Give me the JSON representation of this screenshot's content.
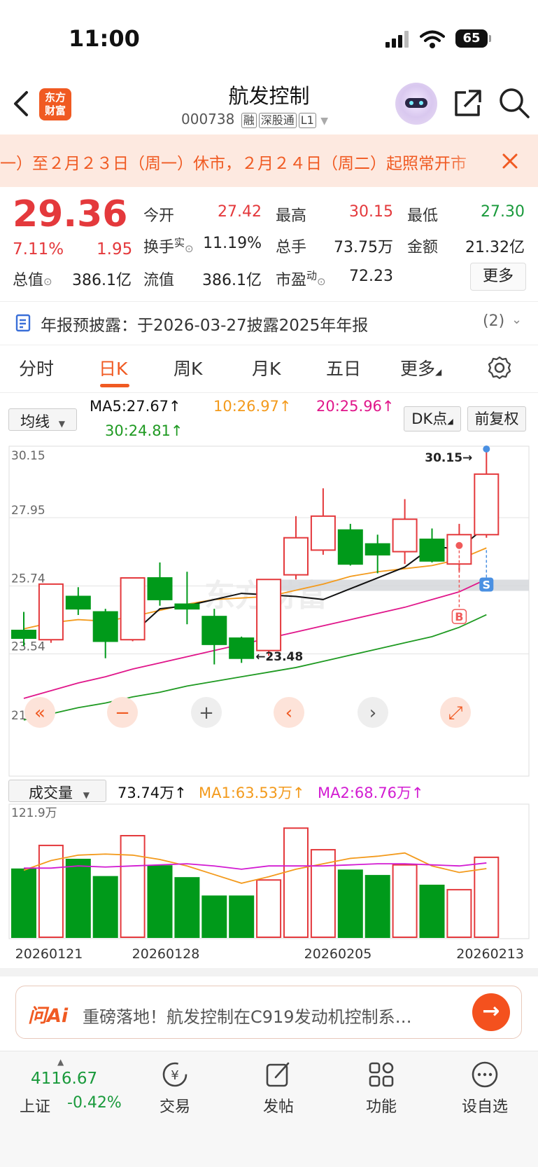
{
  "status_bar": {
    "time": "11:00",
    "battery": "65"
  },
  "header": {
    "logo_text_1": "东方",
    "logo_text_2": "财富",
    "stock_name": "航发控制",
    "stock_code": "000738",
    "tags": [
      "融",
      "深股通",
      "L1"
    ]
  },
  "notice": {
    "text": "一）至２月２３日（周一）休市，２月２４日（周二）起照常开市"
  },
  "quote": {
    "price": "29.36",
    "change_pct": "7.11%",
    "change": "1.95",
    "stats": [
      {
        "label": "今开",
        "value": "27.42",
        "color": "red"
      },
      {
        "label": "最高",
        "value": "30.15",
        "color": "red"
      },
      {
        "label": "最低",
        "value": "27.30",
        "color": "green"
      },
      {
        "label": "换手",
        "sup": "实",
        "value": "11.19%",
        "color": "dark"
      },
      {
        "label": "总手",
        "value": "73.75万",
        "color": "dark"
      },
      {
        "label": "金额",
        "value": "21.32亿",
        "color": "dark"
      },
      {
        "label": "总值",
        "value": "386.1亿",
        "color": "dark"
      },
      {
        "label": "流值",
        "value": "386.1亿",
        "color": "dark"
      },
      {
        "label": "市盈",
        "sup": "动",
        "value": "72.23",
        "color": "dark"
      }
    ],
    "more_label": "更多"
  },
  "report": {
    "text": "年报预披露：于2026-03-27披露2025年年报",
    "count": "(2)"
  },
  "tabs": [
    "分时",
    "日K",
    "周K",
    "月K",
    "五日",
    "更多"
  ],
  "active_tab": "日K",
  "ma_legend": {
    "selector": "均线",
    "ma5": "MA5:27.67↑",
    "ma10": "10:26.97↑",
    "ma20": "20:25.96↑",
    "ma30": "30:24.81↑",
    "dk_button": "DK点",
    "fq_button": "前复权"
  },
  "colors": {
    "accent": "#f05a22",
    "up": "#e4393c",
    "down": "#009a1a",
    "ma5": "#111111",
    "ma10": "#f39a1c",
    "ma20": "#e0168a",
    "ma30": "#1f9a22"
  },
  "kline": {
    "y_ticks": [
      "30.15",
      "27.95",
      "25.74",
      "23.54",
      "21.33"
    ],
    "y_range": [
      21.33,
      30.15
    ],
    "high_label": "30.15→",
    "low_label": "←23.48",
    "watermark": "东方财富",
    "marker_b": "B",
    "marker_s": "S"
  },
  "volume": {
    "selector": "成交量",
    "current": "73.74万↑",
    "ma1": "MA1:63.53万↑",
    "ma2": "MA2:68.76万↑",
    "y_max_label": "121.9万",
    "y_max": 121.9
  },
  "chart_data": {
    "type": "candlestick",
    "title": "",
    "dates_shown": [
      "20260121",
      "20260128",
      "20260205",
      "20260213"
    ],
    "candles": [
      {
        "open": 24.3,
        "close": 24.05,
        "high": 24.9,
        "low": 23.8,
        "volume": 63
      },
      {
        "open": 24.0,
        "close": 25.8,
        "high": 25.8,
        "low": 23.9,
        "volume": 85
      },
      {
        "open": 25.4,
        "close": 25.0,
        "high": 25.7,
        "low": 24.8,
        "volume": 72
      },
      {
        "open": 24.9,
        "close": 23.95,
        "high": 25.0,
        "low": 23.4,
        "volume": 56
      },
      {
        "open": 24.0,
        "close": 26.0,
        "high": 26.0,
        "low": 23.95,
        "volume": 94
      },
      {
        "open": 26.0,
        "close": 25.3,
        "high": 26.5,
        "low": 25.1,
        "volume": 66
      },
      {
        "open": 25.15,
        "close": 25.0,
        "high": 26.2,
        "low": 24.5,
        "volume": 55
      },
      {
        "open": 24.75,
        "close": 23.85,
        "high": 25.0,
        "low": 23.2,
        "volume": 38
      },
      {
        "open": 24.05,
        "close": 23.4,
        "high": 24.1,
        "low": 23.25,
        "volume": 38
      },
      {
        "open": 23.65,
        "close": 25.95,
        "high": 25.95,
        "low": 23.48,
        "volume": 53
      },
      {
        "open": 26.1,
        "close": 27.3,
        "high": 28.0,
        "low": 25.95,
        "volume": 101
      },
      {
        "open": 26.9,
        "close": 28.0,
        "high": 28.9,
        "low": 26.75,
        "volume": 81
      },
      {
        "open": 27.55,
        "close": 26.45,
        "high": 27.75,
        "low": 26.4,
        "volume": 62
      },
      {
        "open": 27.1,
        "close": 26.75,
        "high": 27.4,
        "low": 26.15,
        "volume": 57
      },
      {
        "open": 26.85,
        "close": 27.9,
        "high": 28.55,
        "low": 26.45,
        "volume": 67
      },
      {
        "open": 27.25,
        "close": 26.55,
        "high": 27.6,
        "low": 26.5,
        "volume": 48
      },
      {
        "open": 26.45,
        "close": 27.4,
        "high": 27.75,
        "low": 26.2,
        "volume": 44
      },
      {
        "open": 27.4,
        "close": 29.36,
        "high": 30.15,
        "low": 27.3,
        "volume": 74
      }
    ],
    "ma5": [
      null,
      null,
      null,
      null,
      24.2,
      25.0,
      25.1,
      25.3,
      25.5,
      25.45,
      25.4,
      25.3,
      25.65,
      26.0,
      26.35,
      27.0,
      26.95,
      27.67
    ],
    "ma10": [
      24.35,
      24.55,
      24.65,
      24.6,
      24.75,
      24.95,
      25.15,
      25.3,
      25.35,
      25.4,
      25.6,
      25.8,
      26.05,
      26.2,
      26.3,
      26.4,
      26.6,
      26.97
    ],
    "ma20": [
      22.1,
      22.35,
      22.6,
      22.8,
      23.05,
      23.25,
      23.45,
      23.65,
      23.85,
      24.05,
      24.25,
      24.45,
      24.65,
      24.85,
      25.05,
      25.3,
      25.55,
      25.96
    ],
    "ma30": [
      21.4,
      21.6,
      21.8,
      21.95,
      22.15,
      22.3,
      22.5,
      22.65,
      22.8,
      22.95,
      23.1,
      23.3,
      23.5,
      23.7,
      23.9,
      24.1,
      24.4,
      24.81
    ],
    "vol_ma1": [
      62,
      71,
      76,
      77,
      76,
      72,
      66,
      58,
      50,
      56,
      63,
      68,
      73,
      75,
      78,
      66,
      60,
      63.53
    ],
    "vol_ma2": [
      64,
      64,
      66,
      65,
      66,
      67,
      68,
      66,
      63,
      66,
      66,
      66,
      67,
      68,
      68,
      67,
      66,
      68.76
    ]
  },
  "ai_bar": {
    "logo": "问Ai",
    "text": "重磅落地！航发控制在C919发动机控制系…"
  },
  "bottom_nav": {
    "index_value": "4116.67",
    "index_name": "上证",
    "index_change": "-0.42%",
    "items": [
      "交易",
      "发帖",
      "功能",
      "设自选"
    ]
  }
}
